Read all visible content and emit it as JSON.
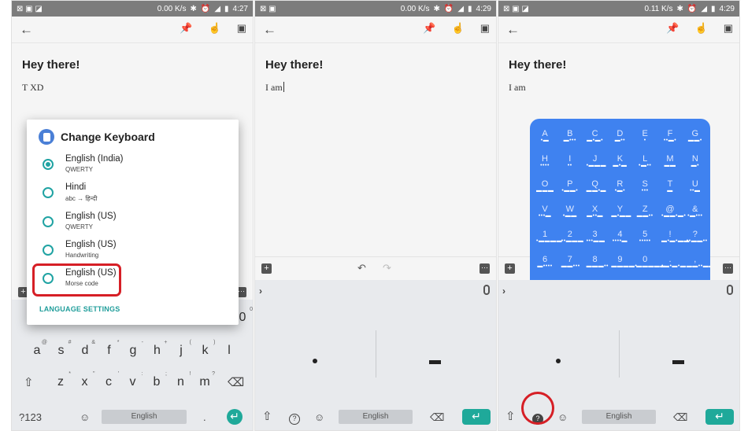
{
  "status_bars": [
    {
      "speed": "0.00 K/s",
      "time": "4:27"
    },
    {
      "speed": "0.00 K/s",
      "time": "4:29"
    },
    {
      "speed": "0.11 K/s",
      "time": "4:29"
    }
  ],
  "note": {
    "title": "Hey there!",
    "body_1": "T XD",
    "body_2": "I am",
    "body_3": "I am"
  },
  "dialog": {
    "title": "Change Keyboard",
    "options": [
      {
        "name": "English (India)",
        "sub": "QWERTY",
        "selected": true
      },
      {
        "name": "Hindi",
        "sub": "abc → हिन्दी",
        "selected": false
      },
      {
        "name": "English (US)",
        "sub": "QWERTY",
        "selected": false
      },
      {
        "name": "English (US)",
        "sub": "Handwriting",
        "selected": false
      },
      {
        "name": "English (US)",
        "sub": "Morse code",
        "selected": false
      }
    ],
    "footer": "LANGUAGE SETTINGS"
  },
  "keyboard": {
    "row2": [
      "a",
      "s",
      "d",
      "f",
      "g",
      "h",
      "j",
      "k",
      "l"
    ],
    "row2_sup": [
      "@",
      "#",
      "&",
      "*",
      "-",
      "+",
      "(",
      ")",
      ""
    ],
    "row3": [
      "z",
      "x",
      "c",
      "v",
      "b",
      "n",
      "m"
    ],
    "row3_sup": [
      "*",
      "\"",
      "'",
      ":",
      ";",
      "!",
      "?"
    ],
    "top_partial_right": "0",
    "top_partial_sup": "0",
    "sym_label": "?123",
    "space_label": "English",
    "period": "."
  },
  "morse_grid": [
    [
      "A",
      "B",
      "C",
      "D",
      "E",
      "F",
      "G"
    ],
    [
      "H",
      "I",
      "J",
      "K",
      "L",
      "M",
      "N"
    ],
    [
      "O",
      "P",
      "Q",
      "R",
      "S",
      "T",
      "U"
    ],
    [
      "V",
      "W",
      "X",
      "Y",
      "Z",
      "@",
      "&"
    ],
    [
      "1",
      "2",
      "3",
      "4",
      "5",
      "!",
      "?"
    ],
    [
      "6",
      "7",
      "8",
      "9",
      "0",
      ".",
      ","
    ]
  ],
  "morse_codes": [
    [
      "•▬",
      "▬•••",
      "▬•▬•",
      "▬••",
      "•",
      "••▬•",
      "▬▬•"
    ],
    [
      "••••",
      "••",
      "•▬▬▬",
      "▬•▬",
      "•▬••",
      "▬▬",
      "▬•"
    ],
    [
      "▬▬▬",
      "•▬▬•",
      "▬▬•▬",
      "•▬•",
      "•••",
      "▬",
      "••▬"
    ],
    [
      "•••▬",
      "•▬▬",
      "▬••▬",
      "▬•▬▬",
      "▬▬••",
      "•▬▬•▬•",
      "•▬•••"
    ],
    [
      "•▬▬▬▬",
      "••▬▬▬",
      "•••▬▬",
      "••••▬",
      "•••••",
      "▬•▬•▬▬",
      "••▬▬••"
    ],
    [
      "▬••••",
      "▬▬•••",
      "▬▬▬••",
      "▬▬▬▬•",
      "▬▬▬▬▬",
      "•▬•▬•▬",
      "▬▬••▬▬"
    ]
  ],
  "colors": {
    "accent": "#1fa99a",
    "highlight": "#d61f26",
    "morse_bg": "#3f82f0"
  }
}
